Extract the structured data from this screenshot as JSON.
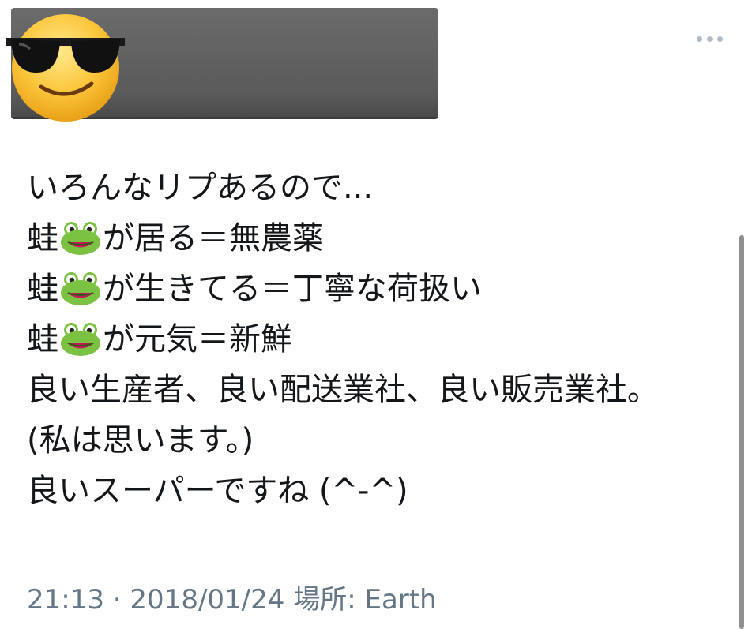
{
  "tweet": {
    "lines": [
      {
        "before": "いろんなリプあるので...",
        "after": ""
      },
      {
        "before": "蛙",
        "after": "が居る＝無農薬"
      },
      {
        "before": "蛙",
        "after": "が生きてる＝丁寧な荷扱い"
      },
      {
        "before": "蛙",
        "after": "が元気＝新鮮"
      },
      {
        "before": "良い生産者、良い配送業社、良い販売業社。",
        "after": ""
      },
      {
        "before": "(私は思います。)",
        "after": ""
      },
      {
        "before": "良いスーパーですね (^-^)",
        "after": ""
      }
    ],
    "emoji": "frog-emoji"
  },
  "meta": {
    "time": "21:13",
    "separator": " · ",
    "date": "2018/01/24",
    "location_label": "場所:",
    "location": "Earth"
  },
  "icons": {
    "avatar": "sunglasses-emoji-avatar",
    "more": "more-dots-icon"
  },
  "colors": {
    "text": "#14171a",
    "meta": "#657786",
    "name_bar": "#5f5f5f",
    "more_dots": "#b3bcc6"
  }
}
